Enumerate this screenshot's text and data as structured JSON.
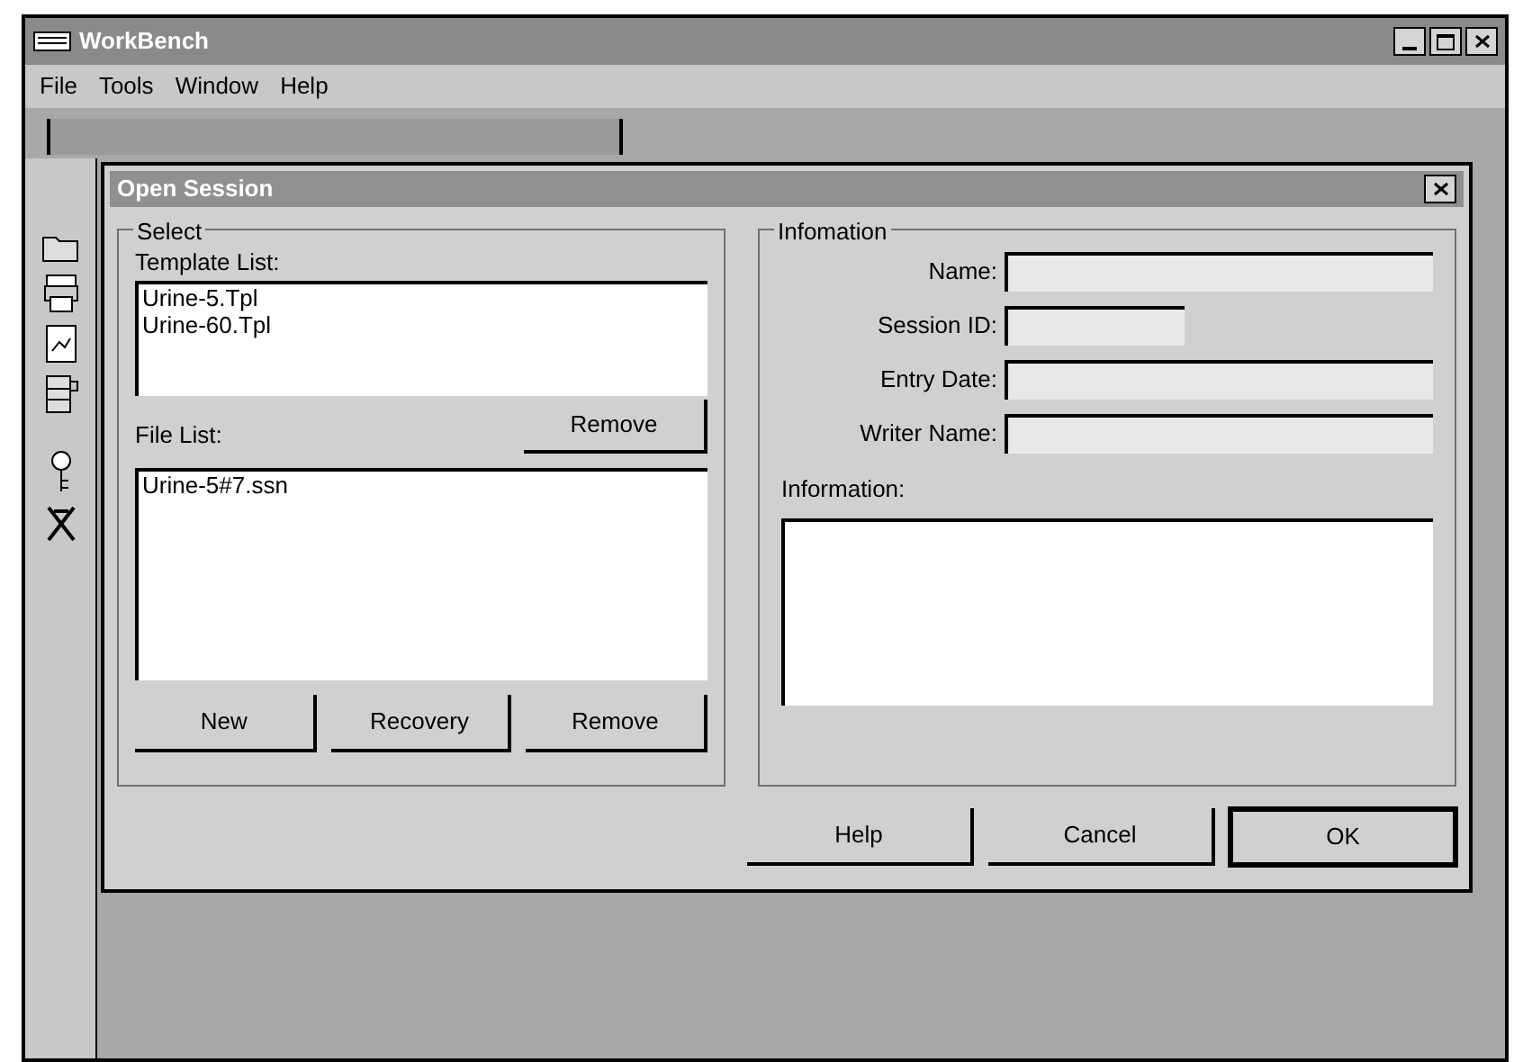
{
  "window": {
    "title": "WorkBench"
  },
  "menu": [
    "File",
    "Tools",
    "Window",
    "Help"
  ],
  "dialog": {
    "title": "Open Session",
    "select": {
      "title": "Select",
      "template_label": "Template List:",
      "templates": [
        "Urine-5.Tpl",
        "Urine-60.Tpl"
      ],
      "template_button": "Remove",
      "file_label": "File List:",
      "files": [
        "Urine-5#7.ssn"
      ],
      "file_buttons": [
        "New",
        "Recovery",
        "Remove"
      ]
    },
    "information": {
      "title": "Infomation",
      "fields": [
        {
          "label": "Name:",
          "kind": "wide"
        },
        {
          "label": "Session ID:",
          "kind": "short"
        },
        {
          "label": "Entry Date:",
          "kind": "wide"
        },
        {
          "label": "Writer Name:",
          "kind": "wide"
        }
      ],
      "notes_label": "Information:"
    },
    "buttons": [
      {
        "label": "Help",
        "default": false
      },
      {
        "label": "Cancel",
        "default": false
      },
      {
        "label": "OK",
        "default": true
      }
    ]
  }
}
